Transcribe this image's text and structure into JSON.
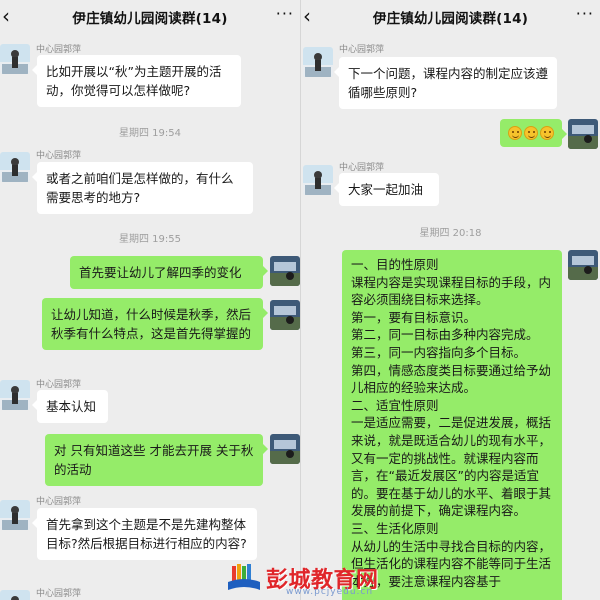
{
  "chat_title": "伊庄镇幼儿园阅读群(14)",
  "more_label": "···",
  "sender_name": "中心园郭萍",
  "left": {
    "messages": [
      {
        "text": "比如开展以“秋”为主题开展的活动，你觉得可以怎样做呢?"
      },
      {
        "timestamp": "星期四 19:54"
      },
      {
        "text": "或者之前咱们是怎样做的，有什么需要思考的地方?"
      },
      {
        "timestamp": "星期四 19:55"
      },
      {
        "text": "首先要让幼儿了解四季的变化"
      },
      {
        "text": "让幼儿知道，什么时候是秋季，然后秋季有什么特点，这是首先得掌握的"
      },
      {
        "text": "基本认知"
      },
      {
        "text": "对 只有知道这些 才能去开展 关于秋 的活动"
      },
      {
        "text": "首先拿到这个主题是不是先建构整体目标?然后根据目标进行相应的内容?"
      }
    ]
  },
  "right": {
    "messages": [
      {
        "text": "下一个问题，课程内容的制定应该遵循哪些原则?"
      },
      {
        "emoji": [
          "smile-face-emoji",
          "smile-face-emoji",
          "smile-face-emoji"
        ]
      },
      {
        "text": "大家一起加油"
      },
      {
        "timestamp": "星期四 20:18"
      },
      {
        "text": "一、目的性原则\n课程内容是实现课程目标的手段，内容必须围绕目标来选择。\n第一，要有目标意识。\n第二，同一目标由多种内容完成。\n第三，同一内容指向多个目标。\n第四，情感态度类目标要通过给予幼儿相应的经验来达成。\n二、适宜性原则\n一是适应需要，二是促进发展，概括来说，就是既适合幼儿的现有水平，又有一定的挑战性。就课程内容而言，在“最近发展区”的内容是适宜的。要在基于幼儿的水平、着眼于其发展的前提下，确定课程内容。\n三、生活化原则\n从幼儿的生活中寻找合目标的内容，但生活化的课程内容不能等同于生活本身，要注意课程内容基于"
      }
    ]
  },
  "watermark": {
    "name": "彭城教育网",
    "url": "www.pcjyedu.cn"
  }
}
